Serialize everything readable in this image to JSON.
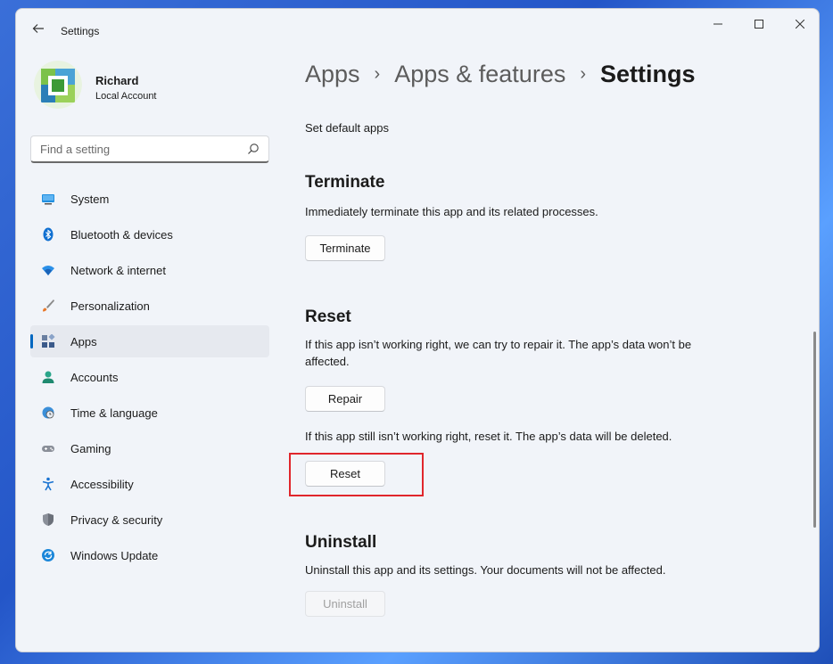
{
  "window": {
    "title": "Settings"
  },
  "profile": {
    "name": "Richard",
    "account_type": "Local Account"
  },
  "search": {
    "placeholder": "Find a setting"
  },
  "nav": {
    "items": [
      {
        "label": "System",
        "icon": "monitor-icon"
      },
      {
        "label": "Bluetooth & devices",
        "icon": "bluetooth-icon"
      },
      {
        "label": "Network & internet",
        "icon": "wifi-icon"
      },
      {
        "label": "Personalization",
        "icon": "brush-icon"
      },
      {
        "label": "Apps",
        "icon": "apps-icon",
        "active": true
      },
      {
        "label": "Accounts",
        "icon": "person-icon"
      },
      {
        "label": "Time & language",
        "icon": "globe-clock-icon"
      },
      {
        "label": "Gaming",
        "icon": "gamepad-icon"
      },
      {
        "label": "Accessibility",
        "icon": "accessibility-icon"
      },
      {
        "label": "Privacy & security",
        "icon": "shield-icon"
      },
      {
        "label": "Windows Update",
        "icon": "update-icon"
      }
    ]
  },
  "breadcrumb": {
    "level1": "Apps",
    "level2": "Apps & features",
    "current": "Settings"
  },
  "content": {
    "default_apps_link": "Set default apps",
    "terminate": {
      "title": "Terminate",
      "description": "Immediately terminate this app and its related processes.",
      "button": "Terminate"
    },
    "reset": {
      "title": "Reset",
      "repair_description": "If this app isn’t working right, we can try to repair it. The app’s data won’t be affected.",
      "repair_button": "Repair",
      "reset_description": "If this app still isn’t working right, reset it. The app’s data will be deleted.",
      "reset_button": "Reset"
    },
    "uninstall": {
      "title": "Uninstall",
      "description": "Uninstall this app and its settings. Your documents will not be affected.",
      "button": "Uninstall"
    }
  },
  "colors": {
    "accent": "#0067c0",
    "highlight": "#e0262c"
  }
}
